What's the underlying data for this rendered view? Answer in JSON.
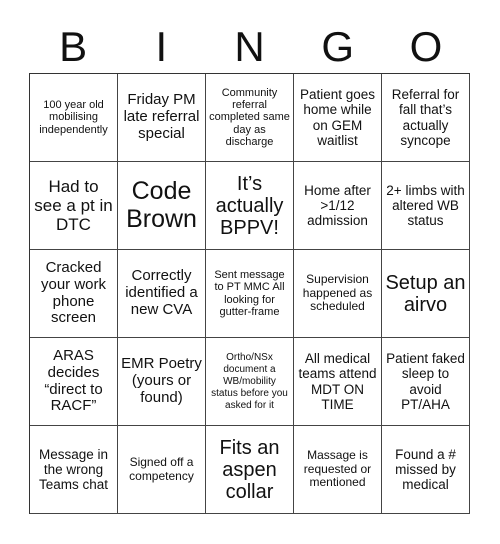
{
  "header": {
    "letters": [
      "B",
      "I",
      "N",
      "G",
      "O"
    ]
  },
  "board": {
    "rows": [
      [
        "100 year old mobilising independently",
        "Friday PM late referral special",
        "Community referral completed same day as discharge",
        "Patient goes home while on GEM waitlist",
        "Referral for fall that’s actually syncope"
      ],
      [
        "Had to see a pt in DTC",
        "Code Brown",
        "It’s actually BPPV!",
        "Home after >1/12 admission",
        "2+ limbs with altered WB status"
      ],
      [
        "Cracked your work phone screen",
        "Correctly identified a new CVA",
        "Sent message to PT MMC All looking for gutter-frame",
        "Supervision happened as scheduled",
        "Setup an airvo"
      ],
      [
        "ARAS decides “direct to RACF”",
        "EMR Poetry (yours or found)",
        "Ortho/NSx document a WB/mobility status before you asked for it",
        "All medical teams attend MDT ON TIME",
        "Patient faked sleep to avoid PT/AHA"
      ],
      [
        "Message in the wrong Teams chat",
        "Signed off a competency",
        "Fits an aspen collar",
        "Massage is requested or mentioned",
        "Found a # missed by medical"
      ]
    ]
  }
}
